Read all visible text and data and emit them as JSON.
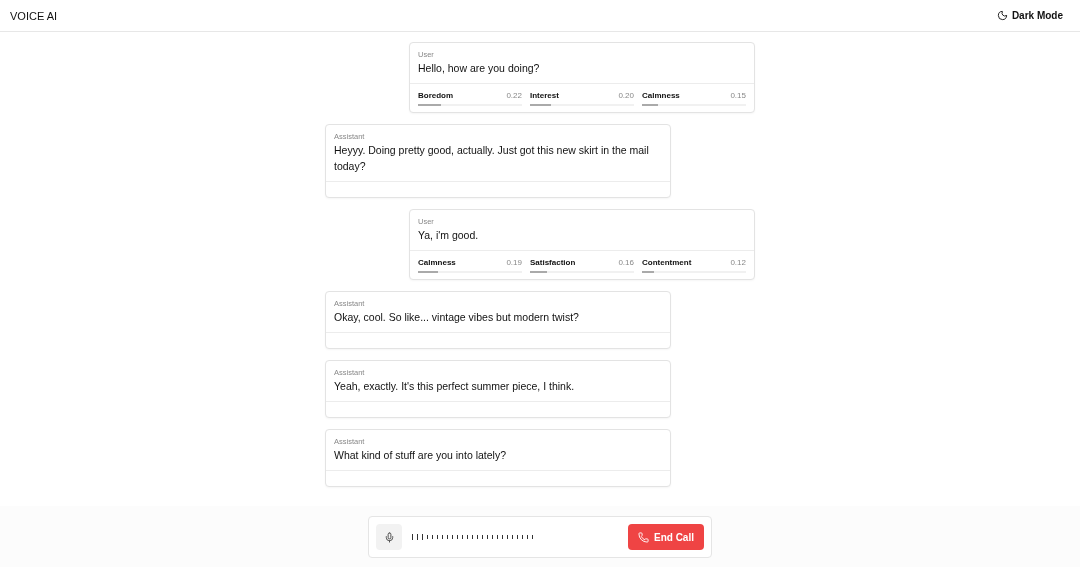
{
  "header": {
    "title": "VOICE AI",
    "theme_button": "Dark Mode"
  },
  "messages": [
    {
      "kind": "user",
      "speaker": "User",
      "text": "Hello, how are you doing?",
      "emotions": [
        {
          "name": "Boredom",
          "score": "0.22",
          "level": 0.22
        },
        {
          "name": "Interest",
          "score": "0.20",
          "level": 0.2
        },
        {
          "name": "Calmness",
          "score": "0.15",
          "level": 0.15
        }
      ]
    },
    {
      "kind": "assistant",
      "speaker": "Assistant",
      "text": "Heyyy. Doing pretty good, actually. Just got this new skirt in the mail today?"
    },
    {
      "kind": "user",
      "speaker": "User",
      "text": "Ya, i'm good.",
      "emotions": [
        {
          "name": "Calmness",
          "score": "0.19",
          "level": 0.19
        },
        {
          "name": "Satisfaction",
          "score": "0.16",
          "level": 0.16
        },
        {
          "name": "Contentment",
          "score": "0.12",
          "level": 0.12
        }
      ]
    },
    {
      "kind": "assistant",
      "speaker": "Assistant",
      "text": "Okay, cool. So like... vintage vibes but modern twist?"
    },
    {
      "kind": "assistant",
      "speaker": "Assistant",
      "text": "Yeah, exactly. It's this perfect summer piece, I think."
    },
    {
      "kind": "assistant",
      "speaker": "Assistant",
      "text": "What kind of stuff are you into lately?"
    }
  ],
  "controls": {
    "end_call": "End Call"
  }
}
